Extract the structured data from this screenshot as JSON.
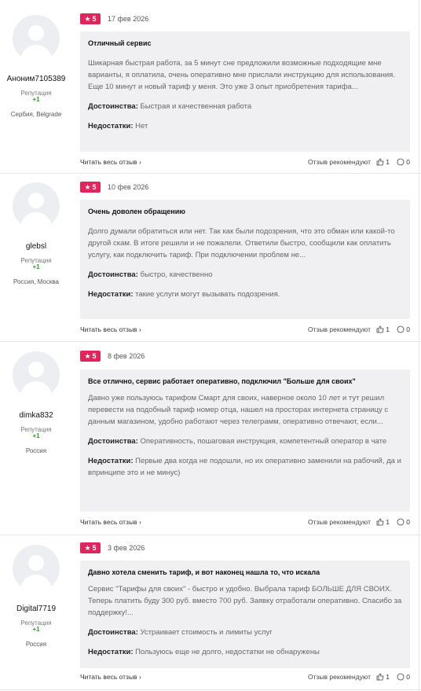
{
  "reviews": [
    {
      "rating": "5",
      "date": "17 фев 2026",
      "user": "Аноним7105389",
      "rep_label": "Репутация",
      "rep_value": "+1",
      "city": "Сербия, Belgrade",
      "title": "Отличный сервис",
      "text": "Шикарная быстрая работа, за 5 минут сне предложили возможные подходящие мне варианты, я оплатила, очень оперативно мне прислали инструкцию для использования. Еще 10 минут и новый тариф у меня. Это уже 3 опыт приобретения тарифа...",
      "pros_label": "Достоинства:",
      "pros": "Быстрая и качественная работа",
      "cons_label": "Недостатки:",
      "cons": "Нет",
      "read_more": "Читать весь отзыв",
      "recommend": "Отзыв рекомендуют",
      "likes": "1",
      "comments": "0"
    },
    {
      "rating": "5",
      "date": "10 фев 2026",
      "user": "glebsl",
      "rep_label": "Репутация",
      "rep_value": "+1",
      "city": "Россия, Москва",
      "title": "Очень доволен обращению",
      "text": "Долго думали обратиться или нет. Так как были подозрения, что это обман или какой-то другой скам. В итоге решили и не пожалели. Ответили быстро, сообщили как оплатить услугу, как подключить тариф. При подключении проблем не...",
      "pros_label": "Достоинства:",
      "pros": "быстро, качественно",
      "cons_label": "Недостатки:",
      "cons": "такие услуги могут вызывать подозрения.",
      "read_more": "Читать весь отзыв",
      "recommend": "Отзыв рекомендуют",
      "likes": "1",
      "comments": "0"
    },
    {
      "rating": "5",
      "date": "8 фев 2026",
      "user": "dimka832",
      "rep_label": "Репутация",
      "rep_value": "+1",
      "city": "Россия",
      "title": "Все отлично, сервис работает оперативно, подключил \"Больше для своих\"",
      "text": "Давно уже пользуюсь тарифом Смарт для своих, наверное около 10 лет и тут решил перевести на подобный тариф номер отца, нашел на просторах интернета страницу с данным магазином, удобно работают через телеграмм, оперативно отвечают, если...",
      "pros_label": "Достоинства:",
      "pros": "Оперативность, пошаговая инструкция, компетентный оператор в чате",
      "cons_label": "Недостатки:",
      "cons": "Первые два когда не подошли, но их оперативно заменили на рабочий, да и впринципе это и не минус)",
      "read_more": "Читать весь отзыв",
      "recommend": "Отзыв рекомендуют",
      "likes": "1",
      "comments": "0"
    },
    {
      "rating": "5",
      "date": "3 фев 2026",
      "user": "Digital7719",
      "rep_label": "Репутация",
      "rep_value": "+1",
      "city": "Россия",
      "title": "Давно хотела сменить тариф, и вот наконец нашла то, что искала",
      "text": "Сервис \"Тарифы для своих\" - быстро и удобно. Выбрала тариф БОЛЬШЕ ДЛЯ СВОИХ. Теперь платить буду 300 руб. вместо 700 руб. Заявку отработали оперативно. Спасибо за поддержку!...",
      "pros_label": "Достоинства:",
      "pros": "Устраивает стоимость и лимиты услуг",
      "cons_label": "Недостатки:",
      "cons": "Пользуюсь еще не долго, недостатки не обнаружены",
      "read_more": "Читать весь отзыв",
      "recommend": "Отзыв рекомендуют",
      "likes": "1",
      "comments": "0"
    }
  ]
}
